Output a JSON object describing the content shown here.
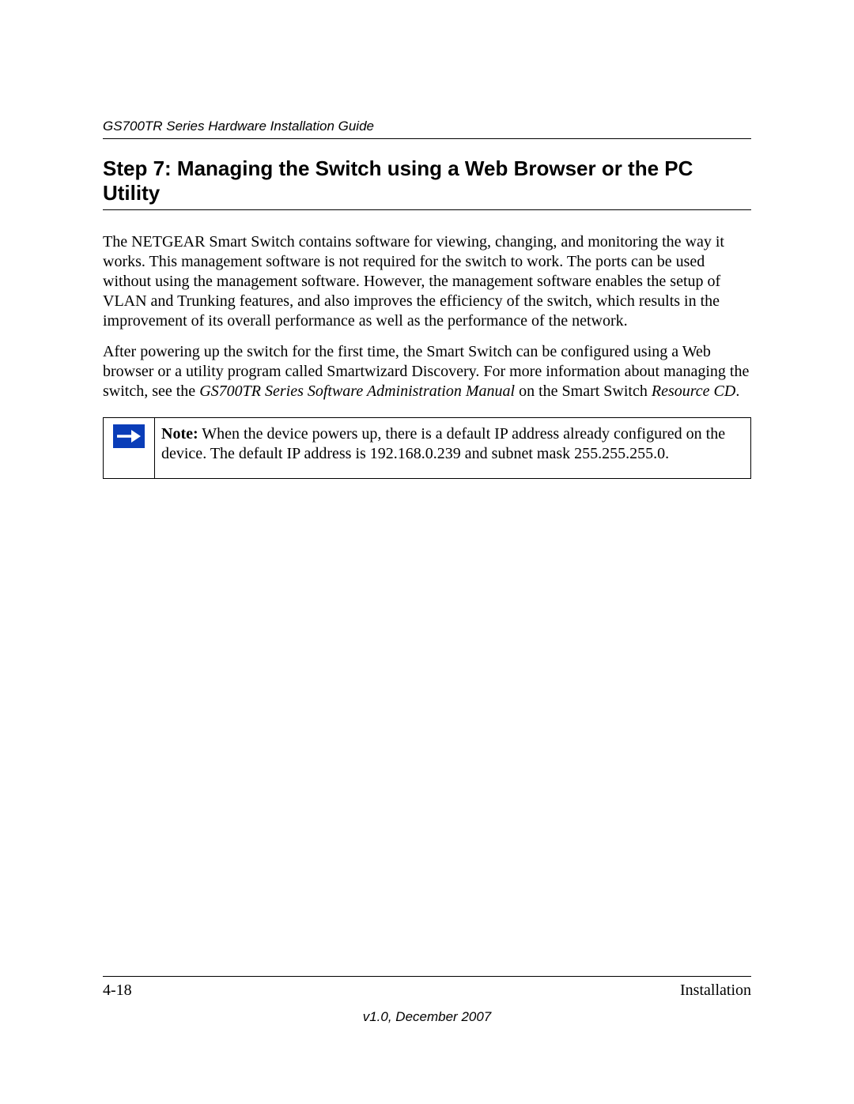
{
  "header": {
    "running_title": "GS700TR Series Hardware Installation Guide"
  },
  "section": {
    "title": "Step 7: Managing the Switch using a Web Browser or the PC Utility"
  },
  "paragraphs": {
    "p1": "The NETGEAR Smart Switch contains software for viewing, changing, and monitoring the way it works. This management software is not required for the switch to work. The ports can be used without using the management software. However, the management software enables the setup of VLAN and Trunking features, and also improves the efficiency of the switch, which results in the improvement of its overall performance as well as the performance of the network.",
    "p2_a": "After powering up the switch for the first time, the Smart Switch can be configured using a Web browser or a utility program called Smartwizard Discovery. For more information about managing the switch, see the ",
    "p2_em1": "GS700TR Series Software Administration Manual",
    "p2_b": " on the Smart Switch ",
    "p2_em2": "Resource CD",
    "p2_c": "."
  },
  "note": {
    "label": "Note:",
    "text": " When the device powers up, there is a default IP address already configured on the device. The default IP address is 192.168.0.239 and subnet mask 255.255.255.0."
  },
  "footer": {
    "page_number": "4-18",
    "section_name": "Installation",
    "version_line": "v1.0, December 2007"
  }
}
